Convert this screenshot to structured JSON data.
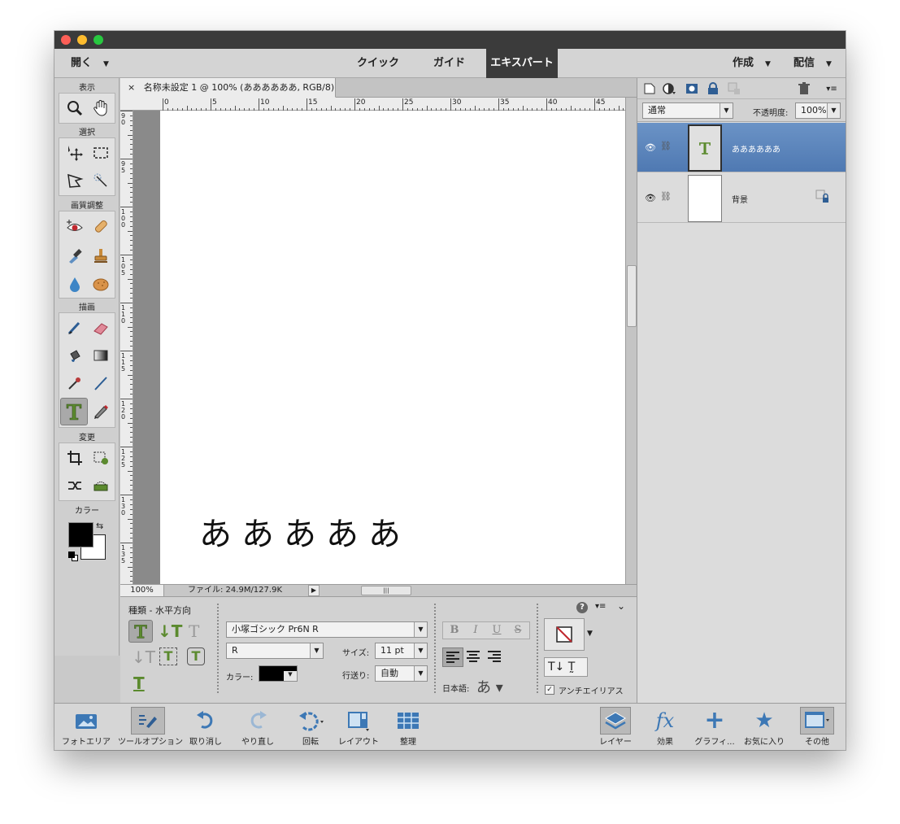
{
  "menubar": {
    "open_label": "開く",
    "tabs": [
      "クイック",
      "ガイド",
      "エキスパート"
    ],
    "create_label": "作成",
    "share_label": "配信"
  },
  "toolbox": {
    "cat_view": "表示",
    "cat_select": "選択",
    "cat_enhance": "画質調整",
    "cat_draw": "描画",
    "cat_modify": "変更",
    "cat_color": "カラー"
  },
  "document": {
    "tab_close": "×",
    "tab_title": "名称未設定 1 @ 100% (ああああああ, RGB/8) *",
    "canvas_text": "あああああ",
    "zoom": "100%",
    "file_info": "ファイル: 24.9M/127.9K",
    "ruler_h": [
      "0",
      "5",
      "10",
      "15",
      "20",
      "25",
      "30",
      "35",
      "40",
      "45"
    ],
    "ruler_v": [
      "90",
      "95",
      "100",
      "105",
      "110",
      "115",
      "120",
      "125",
      "130",
      "135"
    ]
  },
  "layers_panel": {
    "blend_mode": "通常",
    "opacity_label": "不透明度:",
    "opacity_value": "100%",
    "layers": [
      {
        "name": "ああああああ",
        "type": "text",
        "active": true
      },
      {
        "name": "背景",
        "type": "background",
        "active": false
      }
    ]
  },
  "tool_options": {
    "type_label": "種類 - 水平方向",
    "font_family": "小塚ゴシック Pr6N R",
    "font_style": "R",
    "size_label": "サイズ:",
    "size_value": "11 pt",
    "leading_label": "行送り:",
    "leading_value": "自動",
    "color_label": "カラー:",
    "japanese_label": "日本語:",
    "antialias_label": "アンチエイリアス",
    "antialias_checked": true,
    "fmt_bold": "B",
    "fmt_italic": "I",
    "fmt_underline": "U",
    "fmt_strike": "S"
  },
  "bottombar": {
    "photo_bin": "フォトエリア",
    "tool_options": "ツールオプション",
    "undo": "取り消し",
    "redo": "やり直し",
    "rotate": "回転",
    "layout": "レイアウト",
    "organize": "整理",
    "layers": "レイヤー",
    "effects": "効果",
    "graphics": "グラフィ...",
    "favorites": "お気に入り",
    "more": "その他"
  },
  "colors": {
    "accent": "#5a82b9",
    "type_tool_green": "#5b8a2e",
    "foreground": "#000000",
    "background": "#ffffff"
  }
}
